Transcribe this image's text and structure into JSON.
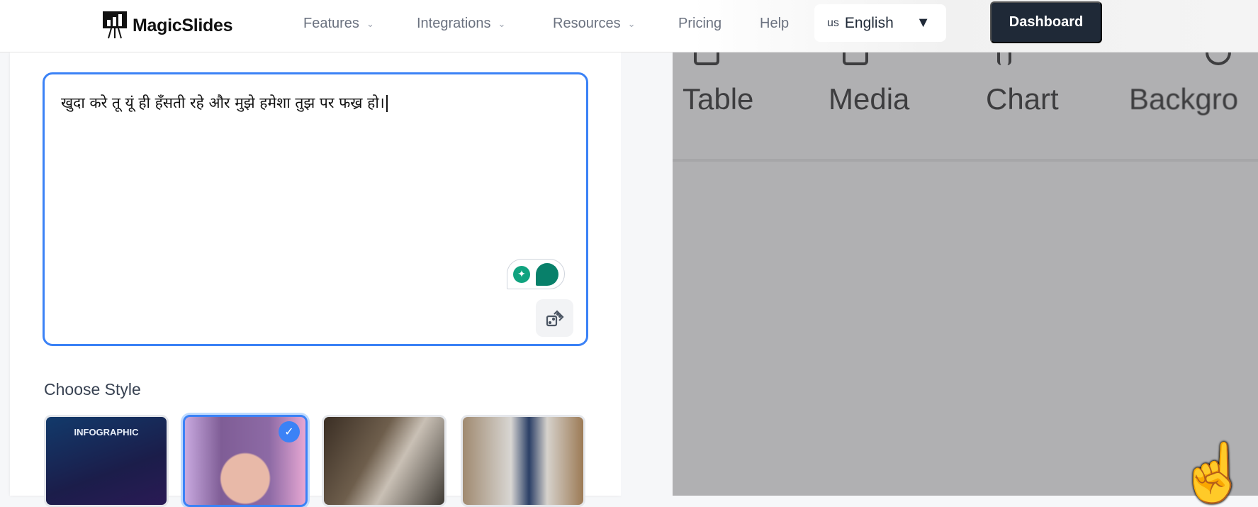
{
  "nav": {
    "brand": "MagicSlides",
    "items": [
      {
        "label": "Features",
        "dropdown": true
      },
      {
        "label": "Integrations",
        "dropdown": true
      },
      {
        "label": "Resources",
        "dropdown": true
      },
      {
        "label": "Pricing",
        "dropdown": false
      },
      {
        "label": "Help",
        "dropdown": false
      }
    ],
    "language": {
      "code": "us",
      "label": "English"
    },
    "dashboard_label": "Dashboard"
  },
  "editor": {
    "text": "खुदा करे तू यूं ही हँसती रहे और मुझे हमेशा तुझ पर फख्र हो।"
  },
  "styles": {
    "heading": "Choose Style",
    "options": [
      {
        "label": "INFOGRAPHIC",
        "selected": false
      },
      {
        "selected": true
      },
      {
        "selected": false
      },
      {
        "selected": false
      }
    ]
  },
  "preview": {
    "tools": [
      "Table",
      "Media",
      "Chart",
      "Backgro"
    ]
  },
  "colors": {
    "accent": "#3b82f6",
    "dark": "#1f2937"
  }
}
